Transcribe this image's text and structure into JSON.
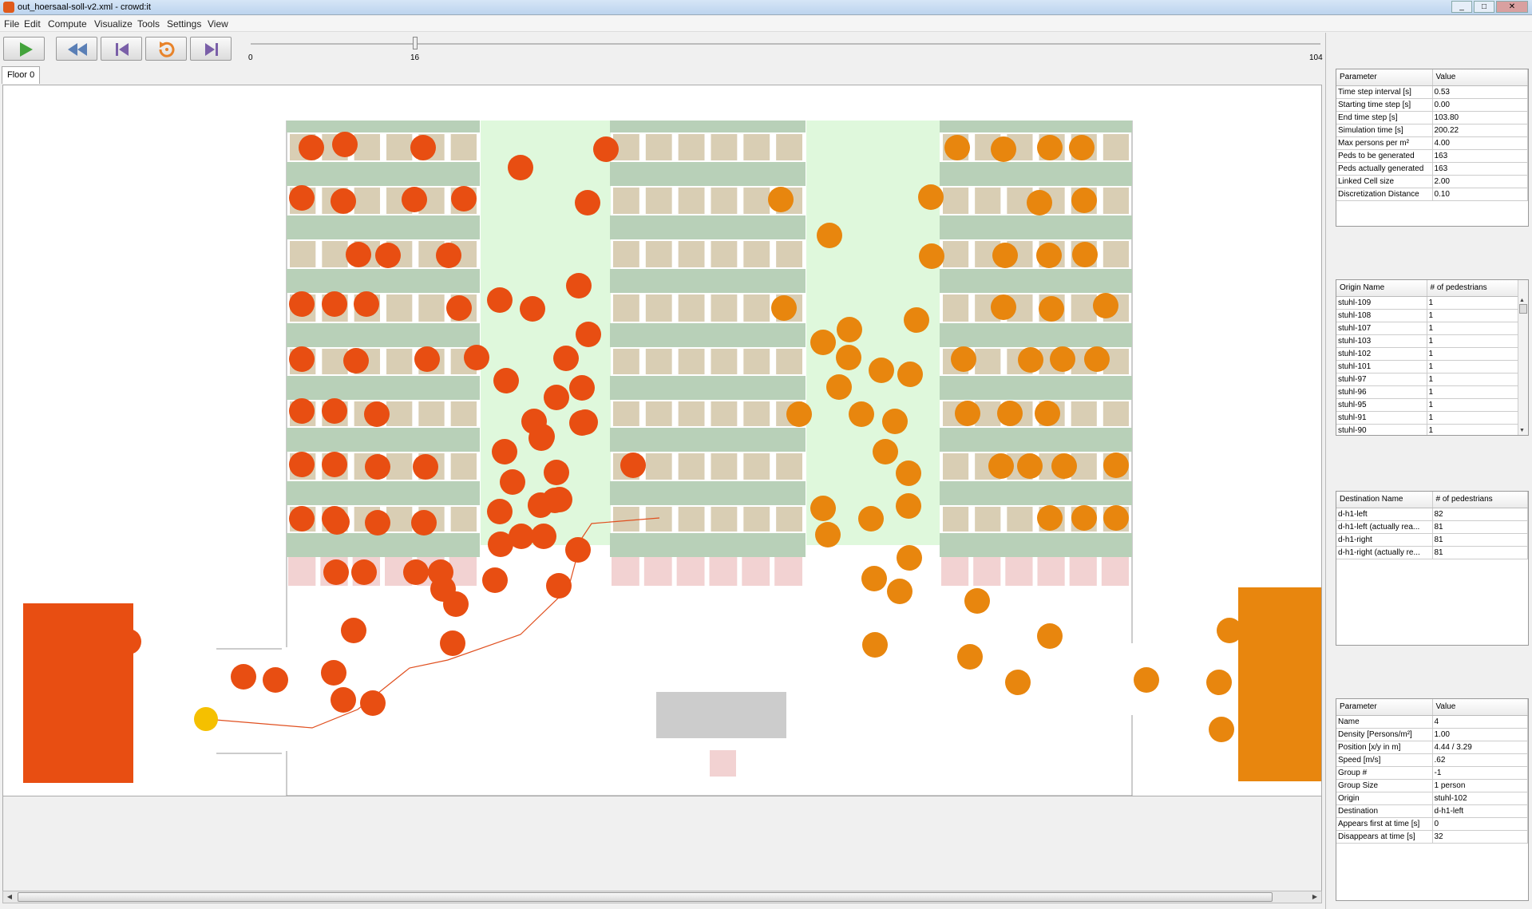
{
  "window": {
    "title": "out_hoersaal-soll-v2.xml - crowd:it",
    "controls": [
      "_",
      "□",
      "✕"
    ]
  },
  "menu": [
    "File",
    "Edit",
    "Compute",
    "Visualize",
    "Tools",
    "Settings",
    "View"
  ],
  "toolbar": {
    "buttons": [
      "play-icon",
      "rewind-icon",
      "skip-to-start-icon",
      "reload-icon",
      "skip-to-end-icon"
    ],
    "accent_play": "#43a33c",
    "accent_nav": "#5a7fb6",
    "accent_reload": "#e8832a",
    "accent_end": "#7a5fa8"
  },
  "timeline": {
    "min": "0",
    "max": "104",
    "current": "16",
    "current_value": 16,
    "max_value": 104
  },
  "tabs": [
    {
      "label": "Floor 0"
    }
  ],
  "colors": {
    "left_group": "#e84e12",
    "right_group": "#e8860e",
    "selected": "#f5c000",
    "track": "#e05020",
    "aisle": "#dff8dc",
    "row": "#b8d0b8",
    "seat": "#d9ceb4",
    "pink": "#f2d2d2",
    "gray": "#cccccc"
  },
  "simulation_params": {
    "headers": [
      "Parameter",
      "Value"
    ],
    "rows": [
      [
        "Time step interval [s]",
        "0.53"
      ],
      [
        "Starting time step [s]",
        "0.00"
      ],
      [
        "End time step [s]",
        "103.80"
      ],
      [
        "Simulation time [s]",
        "200.22"
      ],
      [
        "Max persons per m²",
        "4.00"
      ],
      [
        "Peds to be generated",
        "163"
      ],
      [
        "Peds actually generated",
        "163"
      ],
      [
        "Linked Cell size",
        "2.00"
      ],
      [
        "Discretization Distance",
        "0.10"
      ]
    ]
  },
  "origins": {
    "headers": [
      "Origin Name",
      "# of pedestrians"
    ],
    "rows": [
      [
        "stuhl-109",
        "1"
      ],
      [
        "stuhl-108",
        "1"
      ],
      [
        "stuhl-107",
        "1"
      ],
      [
        "stuhl-103",
        "1"
      ],
      [
        "stuhl-102",
        "1"
      ],
      [
        "stuhl-101",
        "1"
      ],
      [
        "stuhl-97",
        "1"
      ],
      [
        "stuhl-96",
        "1"
      ],
      [
        "stuhl-95",
        "1"
      ],
      [
        "stuhl-91",
        "1"
      ],
      [
        "stuhl-90",
        "1"
      ]
    ]
  },
  "destinations": {
    "headers": [
      "Destination Name",
      "# of pedestrians"
    ],
    "rows": [
      [
        "d-h1-left",
        "82"
      ],
      [
        "d-h1-left (actually rea...",
        "81"
      ],
      [
        "d-h1-right",
        "81"
      ],
      [
        "d-h1-right (actually re...",
        "81"
      ]
    ]
  },
  "pedestrian_params": {
    "headers": [
      "Parameter",
      "Value"
    ],
    "rows": [
      [
        "Name",
        "4"
      ],
      [
        "Density [Persons/m²]",
        "1.00"
      ],
      [
        "Position [x/y in m]",
        "4.44 / 3.29"
      ],
      [
        "Speed [m/s]",
        ".62"
      ],
      [
        "Group #",
        "-1"
      ],
      [
        "Group Size",
        "1 person"
      ],
      [
        "Origin",
        "stuhl-102"
      ],
      [
        "Destination",
        "d-h1-left"
      ],
      [
        "Appears first at time [s]",
        "0"
      ],
      [
        "Disappears at time [s]",
        "32"
      ]
    ]
  }
}
